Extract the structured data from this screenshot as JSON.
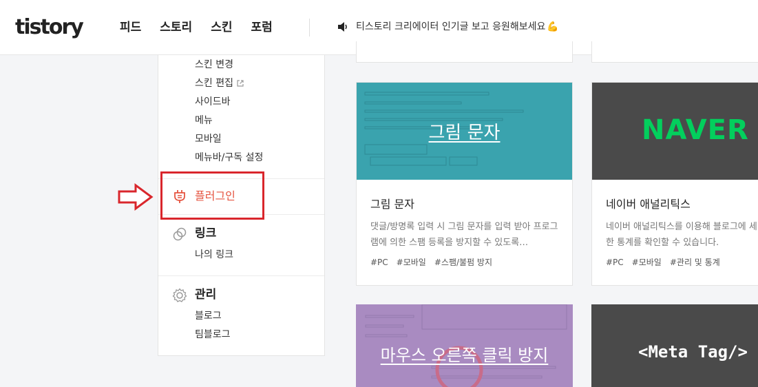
{
  "header": {
    "logo": "tistory",
    "nav": [
      "피드",
      "스토리",
      "스킨",
      "포럼"
    ],
    "notice": "티스토리 크리에이터 인기글 보고 응원해보세요",
    "notice_emoji": "💪"
  },
  "sidebar": {
    "skin_items": [
      "스킨 변경",
      "스킨 편집",
      "사이드바",
      "메뉴",
      "모바일",
      "메뉴바/구독 설정"
    ],
    "plugin": {
      "label": "플러그인",
      "icon": "plug-icon"
    },
    "link": {
      "label": "링크",
      "icon": "link-icon",
      "items": [
        "나의 링크"
      ]
    },
    "manage": {
      "label": "관리",
      "icon": "gear-icon",
      "items": [
        "블로그",
        "팀블로그"
      ]
    }
  },
  "colors": {
    "accent": "#e5533f",
    "highlight": "#d9262c",
    "naver_green": "#03cf5d",
    "captcha_thumb": "#3aa3ae",
    "mouse_thumb": "#a98bc1",
    "dark_thumb": "#4a4a4a"
  },
  "cards": [
    {
      "thumb_caption": "그림 문자",
      "title": "그림 문자",
      "description": "댓글/방명록 입력 시 그림 문자를 입력 받아 프로그램에 의한 스팸 등록을 방지할 수 있도록…",
      "tags": [
        "#PC",
        "#모바일",
        "#스팸/불펌 방지"
      ]
    },
    {
      "thumb_caption": "NAVER",
      "title": "네이버 애널리틱스",
      "description": "네이버 애널리틱스를 이용해 블로그에 세한 통계를 확인할 수 있습니다.",
      "tags": [
        "#PC",
        "#모바일",
        "#관리 및 통계"
      ]
    },
    {
      "thumb_caption": "마우스 오른쪽 클릭 방지"
    },
    {
      "thumb_caption": "<Meta Tag/>"
    }
  ]
}
